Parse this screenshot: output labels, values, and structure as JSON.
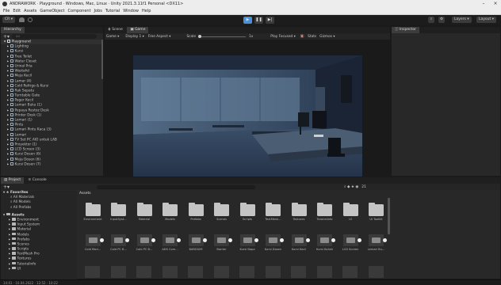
{
  "window": {
    "title": "ANDRAWORK · Playground · Windows, Mac, Linux · Unity 2021.3.11f1 Personal <DX11>",
    "minimize": "–",
    "maximize": "□",
    "close": "×"
  },
  "menu": [
    "File",
    "Edit",
    "Assets",
    "GameObject",
    "Component",
    "Jobs",
    "Tutorial",
    "Window",
    "Help"
  ],
  "toolbar": {
    "account": "CR ▾",
    "layers_label": "Layers",
    "layout_label": "Layout"
  },
  "hierarchy": {
    "tab": "Hierarchy",
    "search_placeholder": "All",
    "scene": "Playground",
    "items": [
      "Lighting",
      "Kursi",
      "Tree Toilet",
      "Water Closet",
      "Urinal Pria",
      "Wastafel",
      "Meja Kecil",
      "Lamar (4)",
      "Cold Refrigo & Kursi",
      "Rak Sepatu",
      "Turntable Gate",
      "Pager Kecil",
      "Lemari Buku (1)",
      "Pepaya Restoz Desk",
      "Printer Desk (1)",
      "Lemari (1)",
      "Pintu",
      "Lemari Pintu Kaca (3)",
      "Lemari",
      "TV Set PC AIO untuk LAB",
      "Proyektor (1)",
      "LCD Screen (3)",
      "Kursi Dosen (6)",
      "Meja Dosen (6)",
      "Kursi Dosen (7)"
    ]
  },
  "scene_tabs": {
    "scene": "Scene",
    "game": "Game",
    "game_label": "Game",
    "display": "Display 1",
    "aspect": "Free Aspect",
    "scale_label": "Scale",
    "scale_value": "1x",
    "play_focused": "Play Focused",
    "stats": "Stats",
    "gizmos": "Gizmos"
  },
  "inspector": {
    "tab": "Inspector"
  },
  "project": {
    "tab": "Project",
    "console_tab": "Console",
    "count": "21",
    "favorites": "Favorites",
    "fav_items": [
      "All Materials",
      "All Models",
      "All Prefabs"
    ],
    "assets_root": "Assets",
    "tree": [
      "Environment",
      "Input System",
      "Material",
      "Models",
      "Prefabs",
      "Scenes",
      "Scripts",
      "TextMesh Pro",
      "Textures",
      "Tutorialinfo",
      "UI"
    ],
    "breadcrumb": "Assets",
    "folders": [
      "Environment",
      "InputSyst...",
      "Material",
      "Models",
      "Prefabs",
      "Scenes",
      "Scripts",
      "TextMesh...",
      "Textures",
      "Tutorialinfo",
      "UI",
      "UI Toolkit"
    ],
    "models": [
      "Cold Mod...",
      "Cold PC B...",
      "Cold PC B...",
      "ADS Com...",
      "BARDIUM",
      "Barrier",
      "Kursi Bapa",
      "Kursi Dosen",
      "Kursi Kecil",
      "Kursi Kuliah",
      "LCD Screen",
      "Lemari Bu..."
    ]
  },
  "status": {
    "text": "14:01 · 10.04.2022 · 12:52 · 10:22"
  }
}
